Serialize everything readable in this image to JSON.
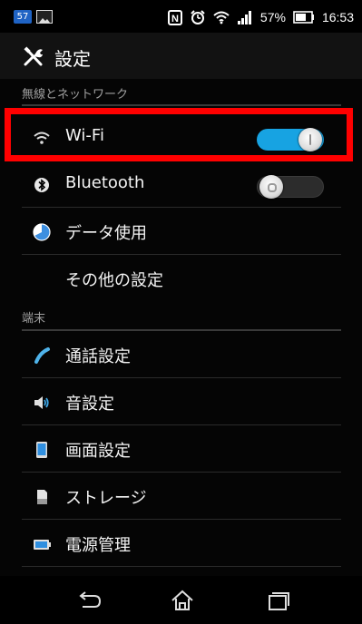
{
  "status_bar": {
    "notification_badge": "57",
    "icons": [
      "image-icon",
      "nfc-icon",
      "alarm-icon",
      "wifi-icon",
      "signal-icon",
      "battery-icon"
    ],
    "battery_percent": "57%",
    "time": "16:53"
  },
  "app_bar": {
    "icon": "settings-wrench-icon",
    "title": "設定"
  },
  "sections": {
    "wireless": {
      "header": "無線とネットワーク",
      "items": [
        {
          "label": "Wi-Fi",
          "icon": "wifi-icon",
          "toggle": true
        },
        {
          "label": "Bluetooth",
          "icon": "bluetooth-icon",
          "toggle": false
        },
        {
          "label": "データ使用",
          "icon": "data-usage-icon"
        },
        {
          "label": "その他の設定",
          "icon": ""
        }
      ]
    },
    "device": {
      "header": "端末",
      "items": [
        {
          "label": "通話設定",
          "icon": "phone-icon"
        },
        {
          "label": "音設定",
          "icon": "speaker-icon"
        },
        {
          "label": "画面設定",
          "icon": "display-icon"
        },
        {
          "label": "ストレージ",
          "icon": "storage-icon"
        },
        {
          "label": "電源管理",
          "icon": "battery-icon"
        }
      ]
    }
  },
  "nav_bar": {
    "buttons": [
      "back-icon",
      "home-icon",
      "recent-apps-icon"
    ]
  },
  "colors": {
    "toggle_on": "#17a3e2",
    "highlight": "#ff0000",
    "background": "#050505"
  }
}
